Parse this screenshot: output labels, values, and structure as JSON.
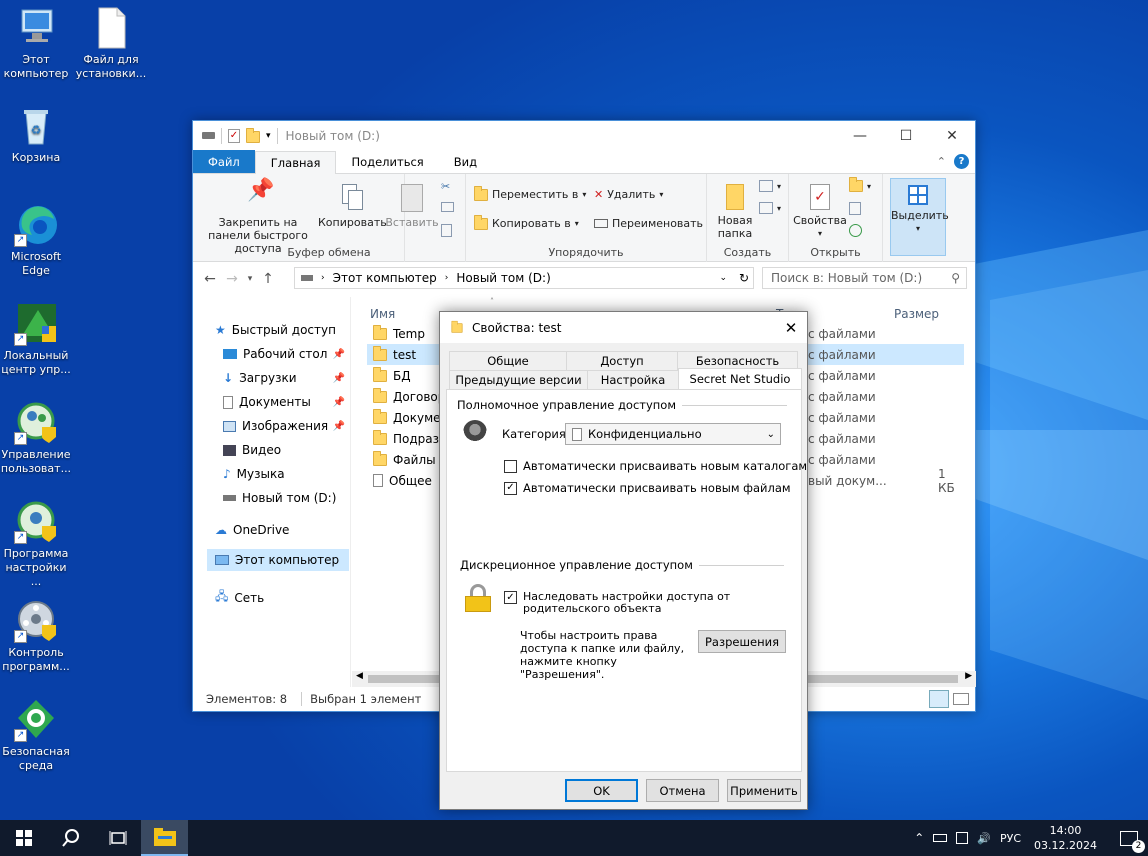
{
  "desktop": {
    "icons": [
      {
        "label": "Этот компьютер"
      },
      {
        "label": "Файл для установки..."
      },
      {
        "label": "Корзина"
      },
      {
        "label": "Microsoft Edge"
      },
      {
        "label": "Локальный центр упр..."
      },
      {
        "label": "Управление пользоват..."
      },
      {
        "label": "Программа настройки ..."
      },
      {
        "label": "Контроль программ..."
      },
      {
        "label": "Безопасная среда"
      }
    ]
  },
  "explorer": {
    "title": "Новый том (D:)",
    "tabs": {
      "file": "Файл",
      "home": "Главная",
      "share": "Поделиться",
      "view": "Вид"
    },
    "ribbon": {
      "pin": "Закрепить на панели быстрого доступа",
      "copy": "Копировать",
      "paste": "Вставить",
      "clipboard_group": "Буфер обмена",
      "move_to": "Переместить в",
      "copy_to": "Копировать в",
      "delete": "Удалить",
      "rename": "Переименовать",
      "organize_group": "Упорядочить",
      "new_folder": "Новая папка",
      "create_group": "Создать",
      "properties": "Свойства",
      "open_group": "Открыть",
      "select": "Выделить"
    },
    "address": {
      "root": "Этот компьютер",
      "current": "Новый том (D:)",
      "search_placeholder": "Поиск в: Новый том (D:)"
    },
    "nav": {
      "quick": "Быстрый доступ",
      "desktop": "Рабочий стол",
      "downloads": "Загрузки",
      "documents": "Документы",
      "pictures": "Изображения",
      "video": "Видео",
      "music": "Музыка",
      "drive": "Новый том (D:)",
      "onedrive": "OneDrive",
      "thispc": "Этот компьютер",
      "network": "Сеть"
    },
    "columns": {
      "name": "Имя",
      "type": "Т",
      "size": "Размер"
    },
    "files": [
      {
        "name": "Temp",
        "type": "с файлами",
        "size": ""
      },
      {
        "name": "test",
        "type": "с файлами",
        "size": ""
      },
      {
        "name": "БД",
        "type": "с файлами",
        "size": ""
      },
      {
        "name": "Договоры",
        "type": "с файлами",
        "size": ""
      },
      {
        "name": "Документы",
        "type": "с файлами",
        "size": ""
      },
      {
        "name": "Подразделения",
        "type": "с файлами",
        "size": ""
      },
      {
        "name": "Файлы",
        "type": "с файлами",
        "size": ""
      },
      {
        "name": "Общее",
        "type": "вый докум...",
        "size": "1 КБ"
      }
    ],
    "status": {
      "count": "Элементов: 8",
      "selected": "Выбран 1 элемент"
    }
  },
  "dialog": {
    "title": "Свойства: test",
    "tabs": {
      "general": "Общие",
      "access": "Доступ",
      "security": "Безопасность",
      "previous": "Предыдущие версии",
      "settings": "Настройка",
      "sns": "Secret Net Studio"
    },
    "mandatory_header": "Полномочное управление доступом",
    "category_label": "Категория:",
    "category_value": "Конфиденциально",
    "auto_dirs": "Автоматически присваивать новым каталогам",
    "auto_files": "Автоматически присваивать новым файлам",
    "discretionary_header": "Дискреционное управление доступом",
    "inherit": "Наследовать настройки доступа от родительского объекта",
    "hint": "Чтобы настроить права доступа к папке или файлу, нажмите кнопку \"Разрешения\".",
    "permissions": "Разрешения",
    "ok": "OK",
    "cancel": "Отмена",
    "apply": "Применить"
  },
  "taskbar": {
    "lang": "РУС",
    "time": "14:00",
    "date": "03.12.2024",
    "notifications": "2"
  }
}
